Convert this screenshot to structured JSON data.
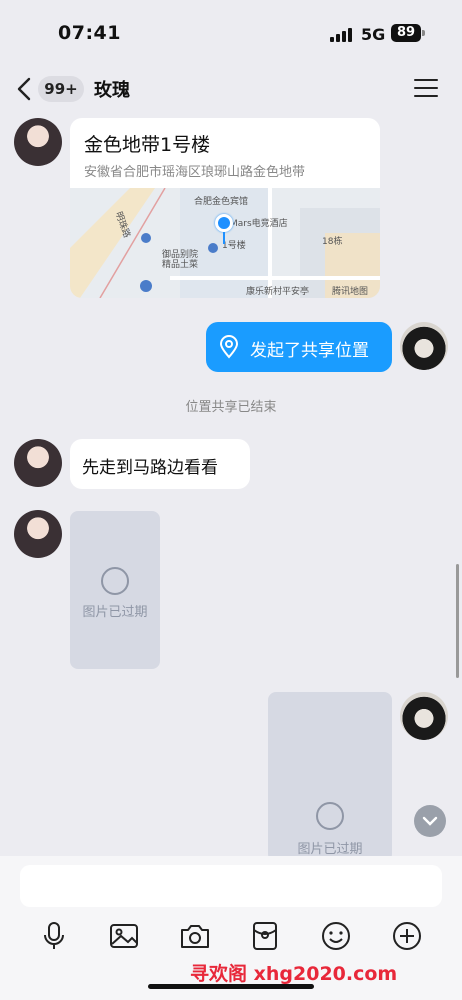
{
  "status_bar": {
    "time": "07:41",
    "network": "5G",
    "battery": "89"
  },
  "header": {
    "unread_badge": "99+",
    "title": "玫瑰"
  },
  "messages": {
    "location_card": {
      "title": "金色地带1号楼",
      "address": "安徽省合肥市瑶海区琅琊山路金色地带",
      "map_labels": {
        "hotel1": "合肥金色宾馆",
        "hotel2": "Mars电竞酒店",
        "building": "1号楼",
        "road": "明珠路",
        "restaurant": "御品别院 精品土菜",
        "building18": "18栋",
        "store": "康乐新村平安亭",
        "provider": "腾讯地图"
      }
    },
    "share_location": "发起了共享位置",
    "system_notice": "位置共享已结束",
    "text_in": "先走到马路边看看",
    "image_expired_1": "图片已过期",
    "image_expired_2": "图片已过期"
  },
  "watermark": "寻欢阁 xhg2020.com",
  "colors": {
    "accent": "#1a9cff",
    "watermark": "#e8283a",
    "background": "#ececf1"
  }
}
